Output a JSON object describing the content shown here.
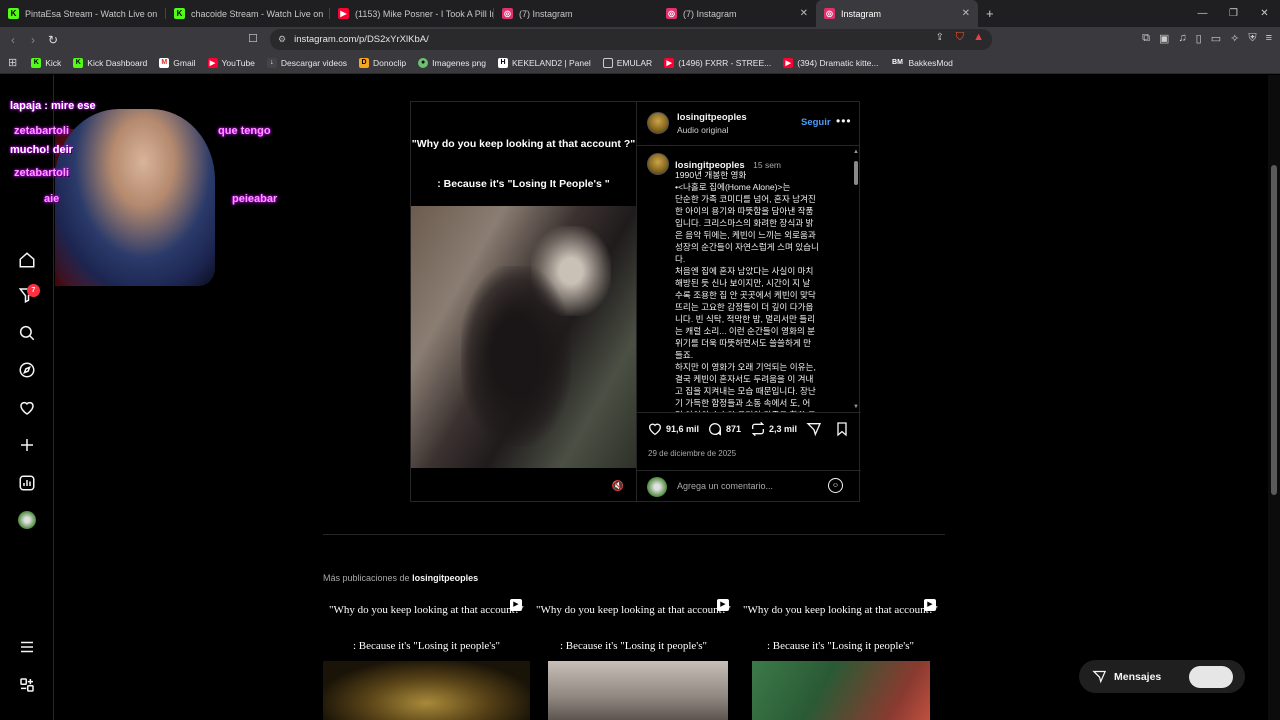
{
  "browser": {
    "tabs": [
      {
        "label": "PintaEsa Stream - Watch Live on",
        "icon": "kick-icon",
        "color": "#53fc18"
      },
      {
        "label": "chacoide Stream - Watch Live on",
        "icon": "kick-icon",
        "color": "#53fc18"
      },
      {
        "label": "(1153) Mike Posner - I Took A Pill In I",
        "icon": "youtube-icon",
        "color": "#ff0033"
      },
      {
        "label": "(7) Instagram",
        "icon": "instagram-icon",
        "color": "#e1306c"
      },
      {
        "label": "(7) Instagram",
        "icon": "instagram-icon",
        "color": "#e1306c"
      },
      {
        "label": "Instagram",
        "icon": "instagram-icon",
        "color": "#e1306c"
      }
    ],
    "url": "instagram.com/p/DS2xYrXlKbA/",
    "bookmarks": [
      {
        "label": "Kick",
        "icon": "kick-icon"
      },
      {
        "label": "Kick Dashboard",
        "icon": "kick-icon"
      },
      {
        "label": "Gmail",
        "icon": "gmail-icon"
      },
      {
        "label": "YouTube",
        "icon": "youtube-icon"
      },
      {
        "label": "Descargar videos",
        "icon": "download-icon"
      },
      {
        "label": "Donoclip",
        "icon": "donoclip-icon"
      },
      {
        "label": "Imagenes png",
        "icon": "image-icon"
      },
      {
        "label": "KEKELAND2 | Panel",
        "icon": "panel-icon"
      },
      {
        "label": "EMULAR",
        "icon": "folder-icon"
      },
      {
        "label": "(1496) FXRR - STREE...",
        "icon": "youtube-icon"
      },
      {
        "label": "(394) Dramatic kitte...",
        "icon": "youtube-icon"
      },
      {
        "label": "BakkesMod",
        "icon": "bm-icon"
      }
    ]
  },
  "stream_chat": [
    {
      "user": "lapaja",
      "text": "lapaja : mire ese"
    },
    {
      "user": "zetabartoli",
      "text": "zetabartoli"
    },
    {
      "text": "mucho! deir"
    },
    {
      "user": "zetabartoli",
      "text": "zetabartoli"
    },
    {
      "text": "aie"
    },
    {
      "text": "que tengo"
    },
    {
      "text": "peieabar"
    }
  ],
  "post": {
    "media_caption_line1": "\"Why do you keep looking at that account ?\"",
    "media_caption_line2": ": Because it's \"Losing It People's \"",
    "username": "losingitpeoples",
    "audio": "Audio original",
    "follow_label": "Seguir",
    "caption_user": "losingitpeoples",
    "caption_time": "15 sem",
    "caption": "1990년 개봉한 영화\n•<나홀로 집에(Home Alone)>는\n단순한 가족 코미디를 넘어, 혼자 남겨진\n한 아이의 용기와 따뜻함을 담아낸 작품\n입니다. 크리스마스의 화려한 장식과 밝\n은 음악 뒤에는, 케빈이 느끼는 외로움과\n성장의 순간들이 자연스럽게 스며 있습니\n다.\n처음엔 집에 혼자 남았다는 사실이 마치\n해방된 듯 신나 보이지만, 시간이 지 날\n수록 조용한 집 안 곳곳에서 케빈이 맞닥\n뜨리는 고요한 감정들이 더 깊이 다가옵\n니다. 빈 식탁, 적막한 밤, 멀리서만 들리\n는 캐럴 소리... 이런 순간들이 영화의 분\n위기를 더욱 따뜻하면서도 쓸쓸하게 만\n들죠.\n하지만 이 영화가 오래 기억되는 이유는,\n결국 케빈이 혼자서도 두려움을 이 겨내\n고 집을 지켜내는 모습 때문입니다. 장난\n기 가득한 함정들과 소동 속에서 도, 어\n린 아이의 순수한 용기와 가족을 향한 그",
    "likes": "91,6 mil",
    "comments": "871",
    "reposts": "2,3 mil",
    "date": "29 de diciembre de 2025",
    "comment_placeholder": "Agrega un comentario..."
  },
  "more": {
    "prefix": "Más publicaciones de",
    "user": "losingitpeoples",
    "items": [
      {
        "line1": "\"Why do you keep looking at that account?\"",
        "line2": ": Because it's \"Losing it people's\""
      },
      {
        "line1": "\"Why do you keep looking at that account?\"",
        "line2": ": Because it's \"Losing it people's\""
      },
      {
        "line1": "\"Why do you keep looking at that account?\"",
        "line2": ": Because it's \"Losing it people's\""
      }
    ]
  },
  "messages": {
    "label": "Mensajes"
  },
  "nav_badge": "7",
  "colors": {
    "accent": "#4a9df8",
    "badge": "#ff3040",
    "bg": "#000000"
  }
}
